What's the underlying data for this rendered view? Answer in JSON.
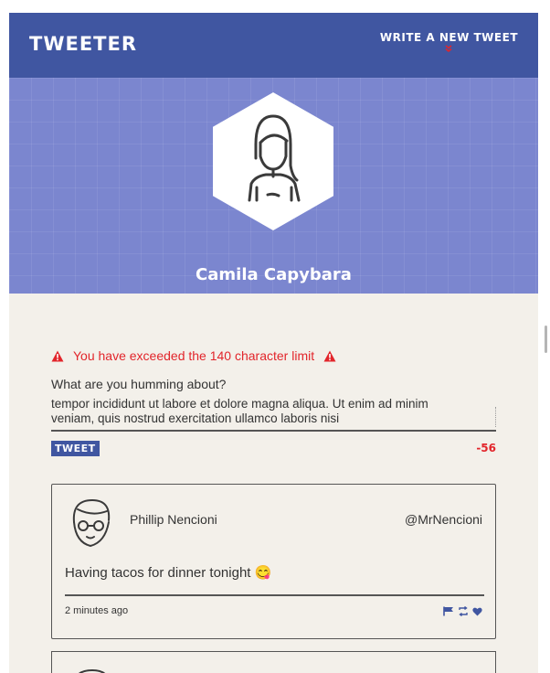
{
  "nav": {
    "brand": "TWEETER",
    "compose_label": "WRITE A NEW TWEET",
    "compose_icon": "double-chevron-down-icon"
  },
  "profile": {
    "name": "Camila Capybara",
    "avatar_icon": "woman-avatar-icon"
  },
  "composer": {
    "error_message": "You have exceeded the 140 character limit",
    "error_icon": "warning-triangle-icon",
    "label": "What are you humming about?",
    "text_line1": "tempor incididunt ut labore et dolore magna aliqua. Ut enim ad minim",
    "text_line2": "veniam, quis nostrud exercitation ullamco laboris nisi",
    "submit_label": "TWEET",
    "counter": "-56"
  },
  "tweets": [
    {
      "name": "Phillip Nencioni",
      "handle": "@MrNencioni",
      "body": "Having tacos for dinner tonight 😋",
      "time": "2 minutes ago",
      "actions": [
        "flag-icon",
        "retweet-icon",
        "heart-icon"
      ]
    }
  ],
  "colors": {
    "nav": "#4056a1",
    "header": "#7b86cf",
    "background": "#f3f0ea",
    "error": "#e2252b"
  }
}
